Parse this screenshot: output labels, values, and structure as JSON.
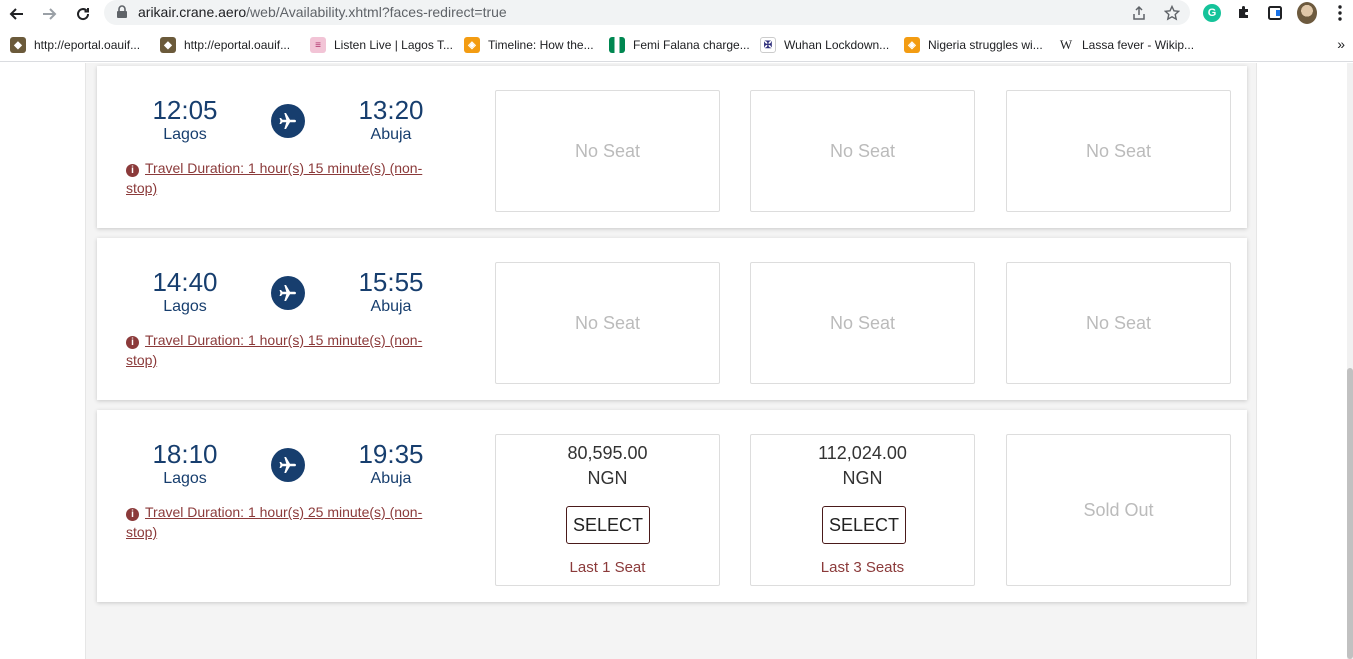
{
  "browser": {
    "url_host": "arikair.crane.aero",
    "url_path": "/web/Availability.xhtml?faces-redirect=true"
  },
  "bookmarks": [
    {
      "label": "http://eportal.oauif...",
      "icon": "university-crest-icon"
    },
    {
      "label": "http://eportal.oauif...",
      "icon": "university-crest-icon"
    },
    {
      "label": "Listen Live | Lagos T...",
      "icon": "radio-icon"
    },
    {
      "label": "Timeline: How the...",
      "icon": "news-icon"
    },
    {
      "label": "Femi Falana charge...",
      "icon": "nigeria-flag-icon"
    },
    {
      "label": "Wuhan Lockdown...",
      "icon": "crest-icon"
    },
    {
      "label": "Nigeria struggles wi...",
      "icon": "news-icon"
    },
    {
      "label": "Lassa fever - Wikip...",
      "icon": "wikipedia-icon"
    }
  ],
  "flights": [
    {
      "depart_time": "12:05",
      "depart_city": "Lagos",
      "arrive_time": "13:20",
      "arrive_city": "Abuja",
      "duration": "Travel Duration: 1 hour(s) 15 minute(s) (non-stop)",
      "fares": [
        {
          "status": "No Seat"
        },
        {
          "status": "No Seat"
        },
        {
          "status": "No Seat"
        }
      ]
    },
    {
      "depart_time": "14:40",
      "depart_city": "Lagos",
      "arrive_time": "15:55",
      "arrive_city": "Abuja",
      "duration": "Travel Duration: 1 hour(s) 15 minute(s) (non-stop)",
      "fares": [
        {
          "status": "No Seat"
        },
        {
          "status": "No Seat"
        },
        {
          "status": "No Seat"
        }
      ]
    },
    {
      "depart_time": "18:10",
      "depart_city": "Lagos",
      "arrive_time": "19:35",
      "arrive_city": "Abuja",
      "duration": "Travel Duration: 1 hour(s) 25 minute(s) (non-stop)",
      "fares": [
        {
          "amount": "80,595.00",
          "currency": "NGN",
          "button": "SELECT",
          "seats_left": "Last 1 Seat"
        },
        {
          "amount": "112,024.00",
          "currency": "NGN",
          "button": "SELECT",
          "seats_left": "Last 3 Seats"
        },
        {
          "status": "Sold Out"
        }
      ]
    }
  ],
  "colors": {
    "brand_navy": "#173e6e",
    "accent_maroon": "#8b3a3a",
    "muted_text": "#bbbbbb"
  }
}
